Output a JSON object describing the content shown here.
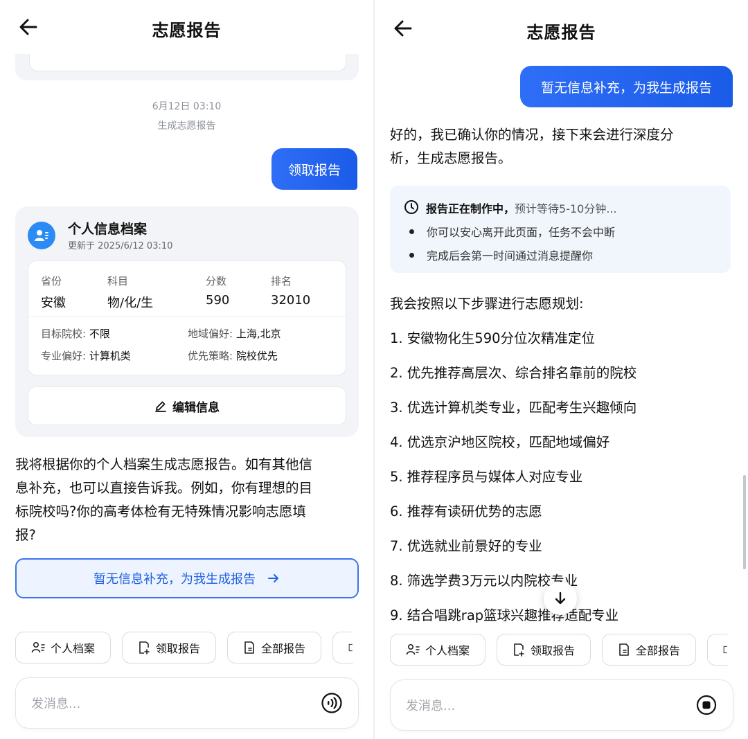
{
  "left": {
    "header": {
      "title": "志愿报告"
    },
    "timestamp": "6月12日 03:10",
    "system_note": "生成志愿报告",
    "user_message": "领取报告",
    "profile": {
      "title": "个人信息档案",
      "updated": "更新于 2025/6/12 03:10",
      "stats": [
        {
          "label": "省份",
          "value": "安徽"
        },
        {
          "label": "科目",
          "value": "物/化/生"
        },
        {
          "label": "分数",
          "value": "590"
        },
        {
          "label": "排名",
          "value": "32010"
        }
      ],
      "prefs": [
        {
          "key": "目标院校: ",
          "value": "不限"
        },
        {
          "key": "地域偏好: ",
          "value": "上海,北京"
        },
        {
          "key": "专业偏好: ",
          "value": "计算机类"
        },
        {
          "key": "优先策略: ",
          "value": "院校优先"
        }
      ],
      "edit_label": "编辑信息"
    },
    "bot_message_lines": [
      "我将根据你的个人档案生成志愿报告。如有其他信",
      "息补充，也可以直接告诉我。例如，你有理想的目",
      "标院校吗?你的高考体检有无特殊情况影响志愿填",
      "报?"
    ],
    "cta_label": "暂无信息补充，为我生成报告",
    "quick_actions": [
      "个人档案",
      "领取报告",
      "全部报告"
    ],
    "input_placeholder": "发消息..."
  },
  "right": {
    "header": {
      "title": "志愿报告"
    },
    "user_message": "暂无信息补充，为我生成报告",
    "bot_reply_lines": [
      "好的，我已确认你的情况，接下来会进行深度分",
      "析，生成志愿报告。"
    ],
    "status": {
      "title_bold": "报告正在制作中，",
      "title_rest": "预计等待5-10分钟...",
      "bullets": [
        "你可以安心离开此页面，任务不会中断",
        "完成后会第一时间通过消息提醒你"
      ]
    },
    "steps_intro": "我会按照以下步骤进行志愿规划:",
    "steps": [
      "1. 安徽物化生590分位次精准定位",
      "2. 优先推荐高层次、综合排名靠前的院校",
      "3. 优选计算机类专业，匹配考生兴趣倾向",
      "4. 优选京沪地区院校，匹配地域偏好",
      "5. 推荐程序员与媒体人对应专业",
      "6. 推荐有读研优势的志愿",
      "7. 优选就业前景好的专业",
      "8. 筛选学费3万元以内院校专业",
      "9. 结合唱跳rap篮球兴趣推荐适配专业"
    ],
    "quick_actions": [
      "个人档案",
      "领取报告",
      "全部报告"
    ],
    "input_placeholder": "发消息..."
  },
  "colors": {
    "accent": "#2f6ef6",
    "status_bg": "#f1f6fc",
    "card_bg": "#f3f4f7"
  },
  "icons": [
    "back-arrow-icon",
    "profile-card-icon",
    "edit-pencil-icon",
    "arrow-right-icon",
    "clock-icon",
    "scroll-down-arrow-icon",
    "voice-icon",
    "stop-icon"
  ]
}
